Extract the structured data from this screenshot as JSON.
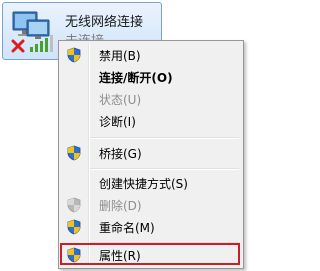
{
  "network": {
    "name": "无线网络连接",
    "status": "未连接",
    "icons": [
      "network-adapter-icon",
      "red-x-icon",
      "signal-bars-icon"
    ]
  },
  "menu": {
    "items": [
      {
        "label": "禁用(B)",
        "icon": "uac-shield-icon",
        "bold": false,
        "disabled": false
      },
      {
        "label": "连接/断开(O)",
        "icon": null,
        "bold": true,
        "disabled": false
      },
      {
        "label": "状态(U)",
        "icon": null,
        "bold": false,
        "disabled": true
      },
      {
        "label": "诊断(I)",
        "icon": null,
        "bold": false,
        "disabled": false
      },
      {
        "label": "桥接(G)",
        "icon": "uac-shield-icon",
        "bold": false,
        "disabled": false
      },
      {
        "label": "创建快捷方式(S)",
        "icon": null,
        "bold": false,
        "disabled": false
      },
      {
        "label": "删除(D)",
        "icon": "uac-shield-icon",
        "bold": false,
        "disabled": true
      },
      {
        "label": "重命名(M)",
        "icon": "uac-shield-icon",
        "bold": false,
        "disabled": false
      },
      {
        "label": "属性(R)",
        "icon": "uac-shield-icon",
        "bold": false,
        "disabled": false
      }
    ],
    "highlighted_item": "属性(R)"
  },
  "colors": {
    "highlight_border": "#c8202a",
    "shield_blue": "#2f6fcf",
    "shield_yellow": "#f2c21b"
  }
}
